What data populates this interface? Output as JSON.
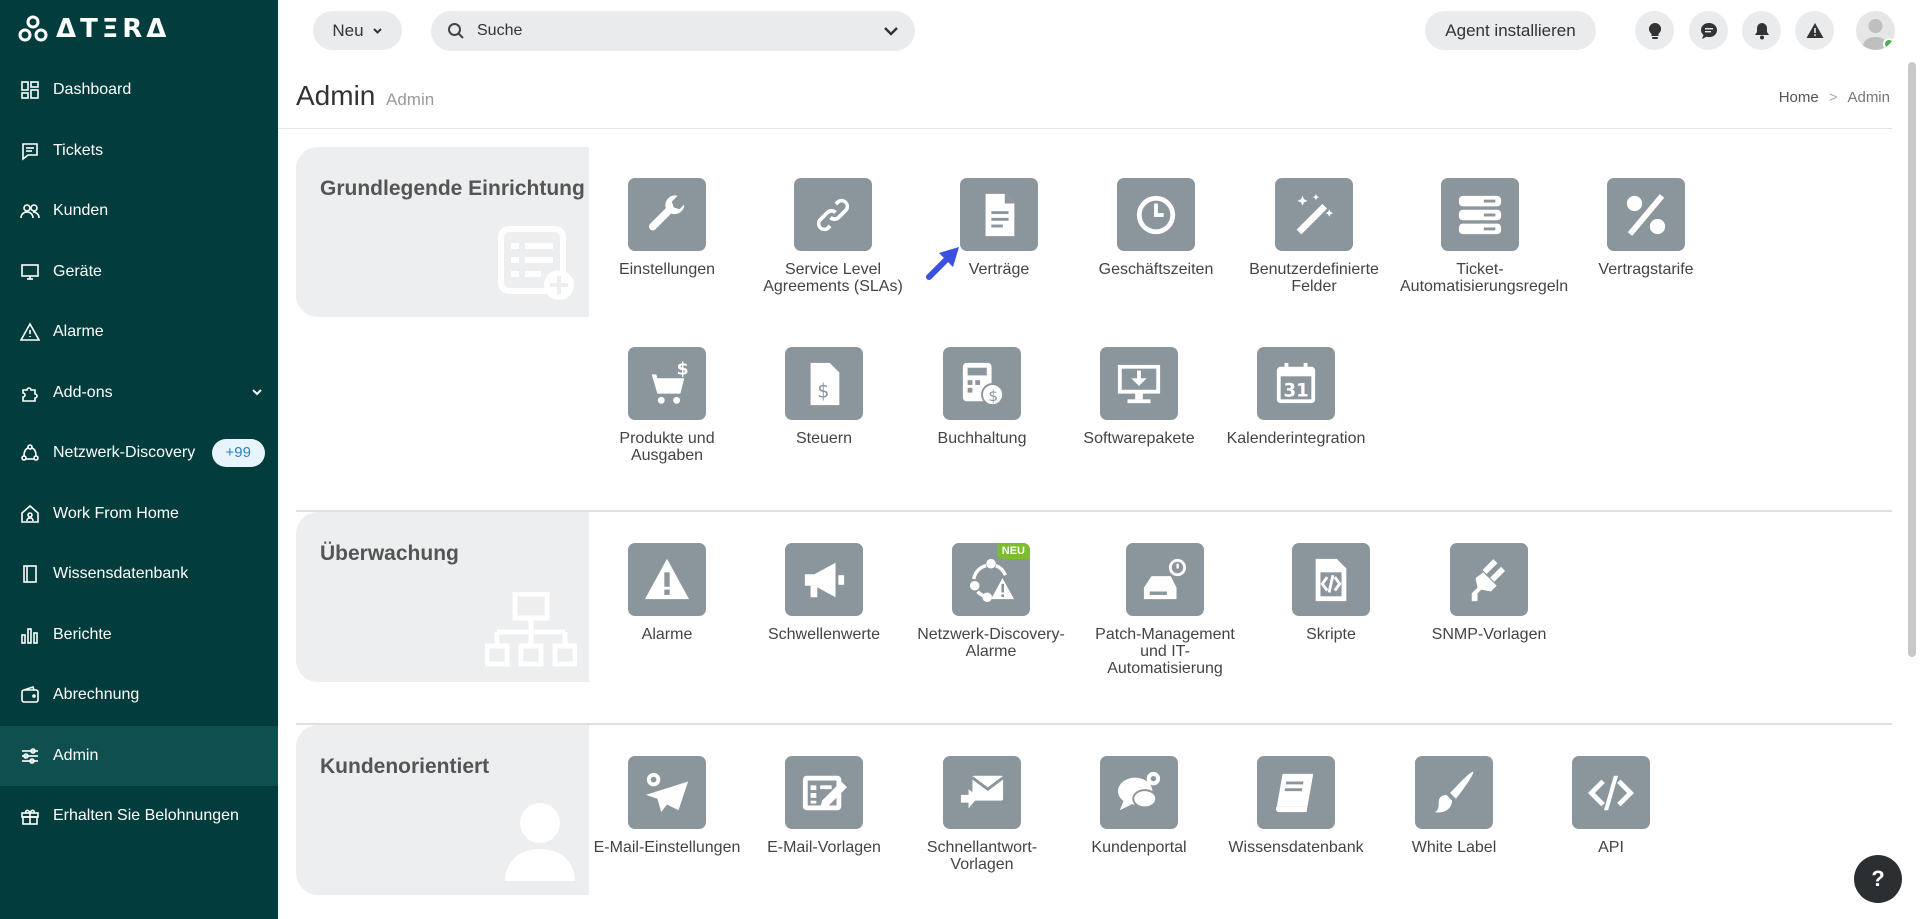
{
  "app": {
    "logo_text": "ΔTΞRΔ"
  },
  "sidebar": {
    "items": [
      {
        "label": "Dashboard",
        "icon": "dashboard-icon"
      },
      {
        "label": "Tickets",
        "icon": "ticket-icon"
      },
      {
        "label": "Kunden",
        "icon": "customers-icon"
      },
      {
        "label": "Geräte",
        "icon": "monitor-icon"
      },
      {
        "label": "Alarme",
        "icon": "warning-icon"
      },
      {
        "label": "Add-ons",
        "icon": "puzzle-icon"
      },
      {
        "label": "Netzwerk-Discovery",
        "icon": "network-icon",
        "badge": "+99"
      },
      {
        "label": "Work From Home",
        "icon": "home-icon"
      },
      {
        "label": "Wissensdatenbank",
        "icon": "book-icon"
      },
      {
        "label": "Berichte",
        "icon": "bar-chart-icon"
      },
      {
        "label": "Abrechnung",
        "icon": "wallet-icon"
      },
      {
        "label": "Admin",
        "icon": "sliders-icon",
        "active": true
      },
      {
        "label": "Erhalten Sie Belohnungen",
        "icon": "gift-icon"
      }
    ]
  },
  "topbar": {
    "new_label": "Neu",
    "search_placeholder": "Suche",
    "agent_label": "Agent installieren",
    "icons": [
      "lightbulb-icon",
      "chat-icon",
      "bell-icon",
      "alert-icon"
    ]
  },
  "header": {
    "title": "Admin",
    "subtitle": "Admin",
    "breadcrumb": {
      "home": "Home",
      "separator": ">",
      "current": "Admin"
    }
  },
  "sections": {
    "setup": {
      "title": "Grundlegende Einrichtung",
      "tiles": [
        {
          "label": "Einstellungen",
          "icon": "wrench-icon"
        },
        {
          "label": "Service Level Agreements (SLAs)",
          "icon": "link-icon"
        },
        {
          "label": "Verträge",
          "icon": "contract-icon"
        },
        {
          "label": "Geschäftszeiten",
          "icon": "clock-icon"
        },
        {
          "label": "Benutzerdefinierte Felder",
          "icon": "magic-wand-icon"
        },
        {
          "label": "Ticket-Automatisierungsregeln",
          "icon": "server-rules-icon"
        },
        {
          "label": "Vertragstarife",
          "icon": "percent-icon"
        },
        {
          "label": "Produkte und Ausgaben",
          "icon": "cart-icon"
        },
        {
          "label": "Steuern",
          "icon": "tax-document-icon"
        },
        {
          "label": "Buchhaltung",
          "icon": "calculator-icon"
        },
        {
          "label": "Softwarepakete",
          "icon": "download-icon"
        },
        {
          "label": "Kalenderintegration",
          "icon": "calendar-icon"
        }
      ]
    },
    "monitoring": {
      "title": "Überwachung",
      "tiles": [
        {
          "label": "Alarme",
          "icon": "warning-icon"
        },
        {
          "label": "Schwellenwerte",
          "icon": "megaphone-icon"
        },
        {
          "label": "Netzwerk-Discovery-Alarme",
          "icon": "network-alert-icon",
          "badge": "NEU"
        },
        {
          "label": "Patch-Management und IT-Automatisierung",
          "icon": "patch-icon"
        },
        {
          "label": "Skripte",
          "icon": "script-icon"
        },
        {
          "label": "SNMP-Vorlagen",
          "icon": "plug-icon"
        }
      ]
    },
    "customer": {
      "title": "Kundenorientiert",
      "tiles": [
        {
          "label": "E-Mail-Einstellungen",
          "icon": "email-settings-icon"
        },
        {
          "label": "E-Mail-Vorlagen",
          "icon": "email-template-icon"
        },
        {
          "label": "Schnellantwort-Vorlagen",
          "icon": "quick-reply-icon"
        },
        {
          "label": "Kundenportal",
          "icon": "portal-icon"
        },
        {
          "label": "Wissensdatenbank",
          "icon": "book-icon"
        },
        {
          "label": "White Label",
          "icon": "brush-icon"
        },
        {
          "label": "API",
          "icon": "code-icon"
        }
      ]
    }
  },
  "help": {
    "label": "?"
  }
}
